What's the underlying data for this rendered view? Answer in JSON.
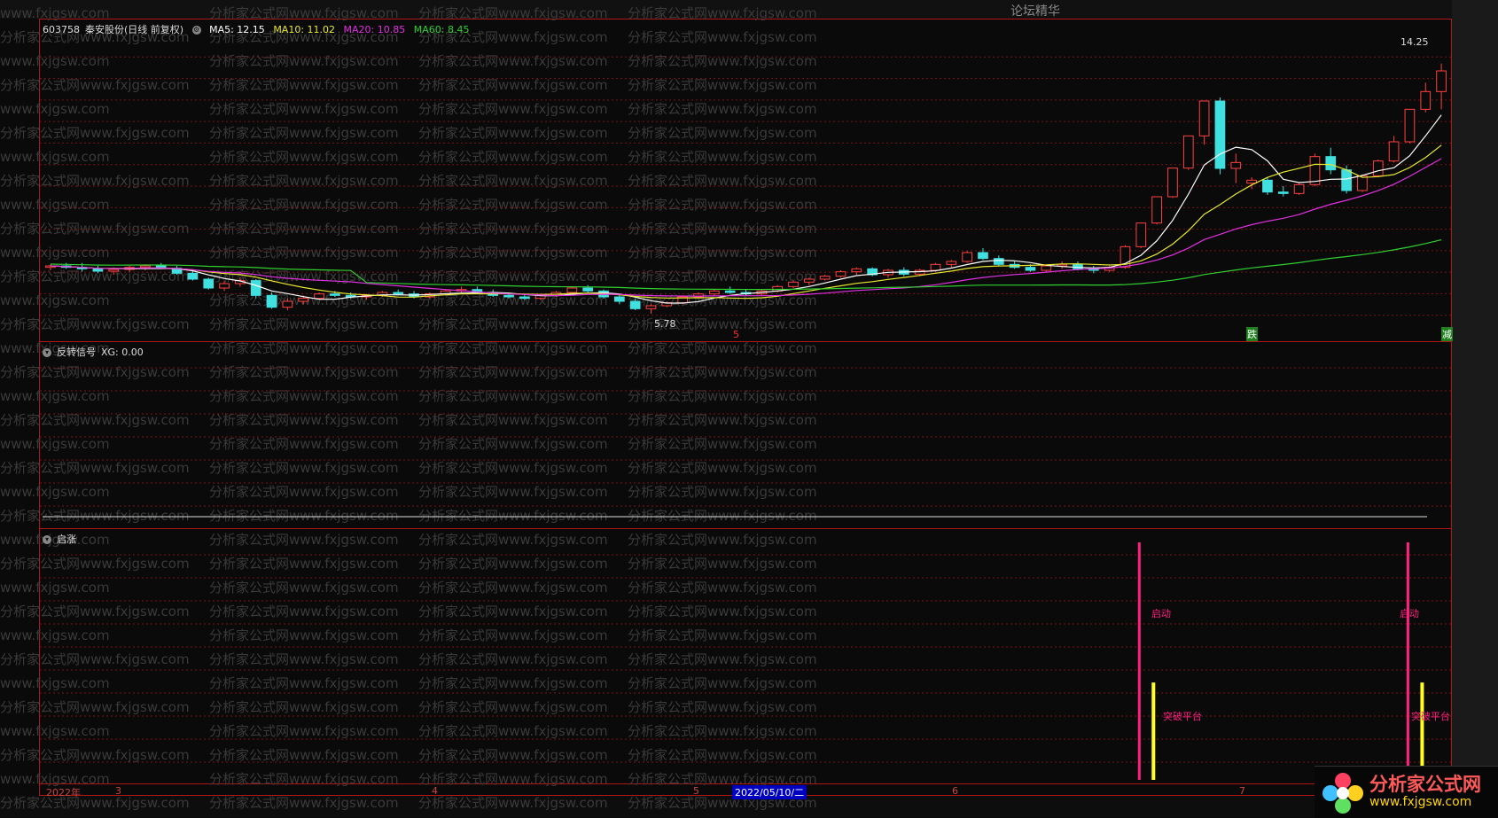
{
  "header": {
    "stock_code": "603758",
    "stock_name": "秦安股份",
    "period": "(日线 前复权)",
    "ma5": "MA5: 12.15",
    "ma10": "MA10: 11.02",
    "ma20": "MA20: 10.85",
    "ma60": "MA60: 8.45"
  },
  "colors": {
    "ma5": "#ffffff",
    "ma10": "#e8e830",
    "ma20": "#e030e0",
    "ma60": "#30d030",
    "up": "#ff4040",
    "down": "#40e0e0",
    "frame": "#b01818",
    "signal_pink": "#ff2080",
    "signal_yellow": "#ffff20"
  },
  "top_tab_text": "论坛精华",
  "panel2": {
    "title": "反转信号",
    "value": "XG: 0.00"
  },
  "panel3": {
    "title": "启涨"
  },
  "annotations": {
    "high_label": "14.25",
    "low_label": "5.78",
    "marker_die": "跌",
    "marker_jian": "减",
    "marker_5": "5",
    "signal_start": "启动",
    "signal_break": "突破平台"
  },
  "time_axis": {
    "year": "2022年",
    "months": [
      "3",
      "4",
      "5",
      "6",
      "7"
    ],
    "cursor_date": "2022/05/10/二"
  },
  "watermark": {
    "line_a": "分析家公式网www.fxjgsw.com",
    "line_b": "www.fxjgsw.com"
  },
  "logo": {
    "name": "分析家公式网",
    "url": "www.fxjgsw.com"
  },
  "chart_data": {
    "type": "candlestick",
    "title": "603758 秦安股份 (日线 前复权)",
    "ylim": [
      5.0,
      15.2
    ],
    "candles": [
      [
        7.35,
        7.45,
        7.25,
        7.4
      ],
      [
        7.4,
        7.5,
        7.3,
        7.35
      ],
      [
        7.35,
        7.5,
        7.2,
        7.3
      ],
      [
        7.3,
        7.4,
        7.15,
        7.22
      ],
      [
        7.22,
        7.35,
        7.1,
        7.28
      ],
      [
        7.28,
        7.4,
        7.2,
        7.35
      ],
      [
        7.35,
        7.45,
        7.25,
        7.4
      ],
      [
        7.4,
        7.5,
        7.3,
        7.32
      ],
      [
        7.32,
        7.4,
        7.1,
        7.15
      ],
      [
        7.15,
        7.25,
        6.9,
        6.95
      ],
      [
        6.95,
        7.0,
        6.6,
        6.65
      ],
      [
        6.65,
        6.9,
        6.55,
        6.8
      ],
      [
        6.8,
        7.0,
        6.7,
        6.9
      ],
      [
        6.9,
        6.95,
        6.3,
        6.4
      ],
      [
        6.4,
        6.5,
        5.95,
        6.0
      ],
      [
        6.0,
        6.3,
        5.9,
        6.2
      ],
      [
        6.2,
        6.4,
        6.1,
        6.3
      ],
      [
        6.3,
        6.5,
        6.25,
        6.45
      ],
      [
        6.45,
        6.55,
        6.35,
        6.4
      ],
      [
        6.4,
        6.5,
        6.3,
        6.35
      ],
      [
        6.35,
        6.45,
        6.25,
        6.4
      ],
      [
        6.4,
        6.55,
        6.35,
        6.5
      ],
      [
        6.5,
        6.6,
        6.4,
        6.45
      ],
      [
        6.45,
        6.55,
        6.3,
        6.35
      ],
      [
        6.35,
        6.5,
        6.3,
        6.45
      ],
      [
        6.45,
        6.6,
        6.4,
        6.55
      ],
      [
        6.55,
        6.7,
        6.5,
        6.6
      ],
      [
        6.6,
        6.7,
        6.45,
        6.5
      ],
      [
        6.5,
        6.6,
        6.35,
        6.4
      ],
      [
        6.4,
        6.5,
        6.3,
        6.35
      ],
      [
        6.35,
        6.45,
        6.25,
        6.3
      ],
      [
        6.3,
        6.45,
        6.25,
        6.4
      ],
      [
        6.4,
        6.55,
        6.35,
        6.5
      ],
      [
        6.5,
        6.7,
        6.45,
        6.65
      ],
      [
        6.65,
        6.75,
        6.5,
        6.55
      ],
      [
        6.55,
        6.6,
        6.3,
        6.35
      ],
      [
        6.35,
        6.45,
        6.1,
        6.2
      ],
      [
        6.2,
        6.3,
        5.9,
        5.95
      ],
      [
        5.95,
        6.1,
        5.78,
        6.05
      ],
      [
        6.05,
        6.2,
        6.0,
        6.15
      ],
      [
        6.15,
        6.4,
        6.1,
        6.35
      ],
      [
        6.35,
        6.5,
        6.3,
        6.45
      ],
      [
        6.45,
        6.6,
        6.4,
        6.55
      ],
      [
        6.55,
        6.7,
        6.45,
        6.5
      ],
      [
        6.5,
        6.6,
        6.4,
        6.45
      ],
      [
        6.45,
        6.6,
        6.4,
        6.55
      ],
      [
        6.55,
        6.75,
        6.5,
        6.7
      ],
      [
        6.7,
        6.9,
        6.65,
        6.85
      ],
      [
        6.85,
        7.0,
        6.75,
        6.95
      ],
      [
        6.95,
        7.1,
        6.9,
        7.05
      ],
      [
        7.05,
        7.25,
        7.0,
        7.2
      ],
      [
        7.2,
        7.35,
        7.1,
        7.3
      ],
      [
        7.3,
        7.35,
        7.05,
        7.1
      ],
      [
        7.1,
        7.3,
        7.0,
        7.25
      ],
      [
        7.25,
        7.35,
        7.05,
        7.12
      ],
      [
        7.12,
        7.3,
        7.05,
        7.25
      ],
      [
        7.25,
        7.5,
        7.2,
        7.45
      ],
      [
        7.45,
        7.6,
        7.35,
        7.55
      ],
      [
        7.55,
        7.9,
        7.5,
        7.85
      ],
      [
        7.85,
        8.0,
        7.6,
        7.65
      ],
      [
        7.65,
        7.75,
        7.4,
        7.45
      ],
      [
        7.45,
        7.55,
        7.3,
        7.35
      ],
      [
        7.35,
        7.45,
        7.2,
        7.25
      ],
      [
        7.25,
        7.45,
        7.2,
        7.4
      ],
      [
        7.4,
        7.55,
        7.3,
        7.45
      ],
      [
        7.45,
        7.55,
        7.25,
        7.3
      ],
      [
        7.3,
        7.4,
        7.15,
        7.25
      ],
      [
        7.25,
        7.4,
        7.2,
        7.35
      ],
      [
        7.35,
        8.1,
        7.3,
        8.05
      ],
      [
        8.05,
        8.85,
        8.0,
        8.85
      ],
      [
        8.85,
        9.74,
        8.8,
        9.74
      ],
      [
        9.74,
        10.71,
        9.7,
        10.71
      ],
      [
        10.71,
        11.8,
        10.65,
        11.8
      ],
      [
        11.8,
        13.0,
        11.5,
        12.98
      ],
      [
        12.98,
        13.1,
        10.5,
        10.7
      ],
      [
        10.7,
        11.2,
        10.2,
        10.9
      ],
      [
        10.2,
        10.4,
        10.0,
        10.3
      ],
      [
        10.3,
        10.4,
        9.8,
        9.9
      ],
      [
        9.9,
        10.1,
        9.75,
        9.85
      ],
      [
        9.85,
        10.2,
        9.8,
        10.15
      ],
      [
        10.15,
        11.2,
        10.1,
        11.1
      ],
      [
        11.1,
        11.4,
        10.5,
        10.65
      ],
      [
        10.65,
        10.8,
        9.85,
        9.95
      ],
      [
        9.95,
        10.5,
        9.9,
        10.45
      ],
      [
        10.45,
        11.0,
        10.4,
        10.95
      ],
      [
        10.95,
        11.8,
        10.9,
        11.6
      ],
      [
        11.6,
        12.7,
        11.55,
        12.7
      ],
      [
        12.7,
        13.6,
        12.6,
        13.3
      ],
      [
        13.3,
        14.25,
        12.7,
        14.0
      ]
    ],
    "ma5_last": 12.15,
    "ma10_last": 11.02,
    "ma20_last": 10.85,
    "ma60_last": 8.45,
    "signals": [
      {
        "index": 69,
        "pink_top": 1.0,
        "yellow_top": 0.5,
        "label_pink": "启动",
        "label_yellow": "突破平台"
      },
      {
        "index": 86,
        "pink_top": 1.0,
        "yellow_top": 0.5,
        "label_pink": "启动",
        "label_yellow": "突破平台"
      }
    ]
  }
}
